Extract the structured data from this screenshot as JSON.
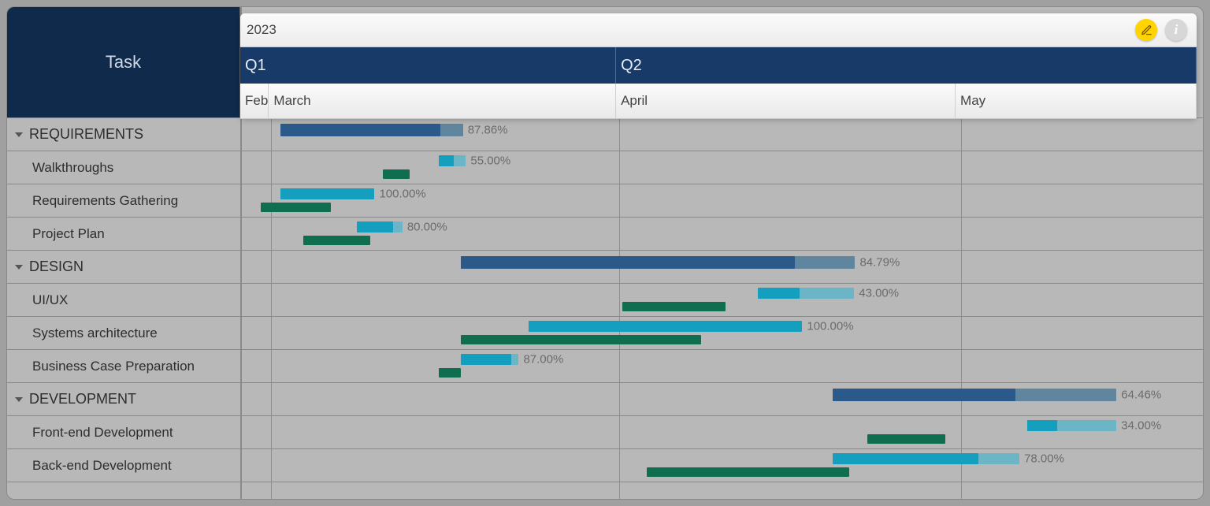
{
  "task_header": "Task",
  "year_label": "2023",
  "quarters": [
    "Q1",
    "Q2"
  ],
  "months": [
    "Feb",
    "March",
    "April",
    "May"
  ],
  "rows": [
    {
      "type": "group",
      "label": "REQUIREMENTS",
      "percent": "87.86%"
    },
    {
      "type": "task",
      "label": "Walkthroughs",
      "percent": "55.00%"
    },
    {
      "type": "task",
      "label": "Requirements Gathering",
      "percent": "100.00%"
    },
    {
      "type": "task",
      "label": "Project Plan",
      "percent": "80.00%"
    },
    {
      "type": "group",
      "label": "DESIGN",
      "percent": "84.79%"
    },
    {
      "type": "task",
      "label": "UI/UX",
      "percent": "43.00%"
    },
    {
      "type": "task",
      "label": "Systems architecture",
      "percent": "100.00%"
    },
    {
      "type": "task",
      "label": "Business Case Preparation",
      "percent": "87.00%"
    },
    {
      "type": "group",
      "label": "DEVELOPMENT",
      "percent": "64.46%"
    },
    {
      "type": "task",
      "label": "Front-end Development",
      "percent": "34.00%"
    },
    {
      "type": "task",
      "label": "Back-end Development",
      "percent": "78.00%"
    }
  ],
  "chart_data": {
    "type": "gantt",
    "xlabel": "",
    "ylabel": "",
    "time_axis_days": {
      "start": "2023-02-26",
      "end": "2023-05-30"
    },
    "tasks": [
      {
        "name": "REQUIREMENTS",
        "kind": "group",
        "progress_pct": 87.86,
        "summary": {
          "startPct": 4.0,
          "widthPct": 19.0
        }
      },
      {
        "name": "Walkthroughs",
        "kind": "task",
        "progress_pct": 55.0,
        "plan": {
          "startPct": 20.5,
          "widthPct": 2.8
        },
        "baseline": {
          "startPct": 14.7,
          "widthPct": 2.8
        }
      },
      {
        "name": "Requirements Gathering",
        "kind": "task",
        "progress_pct": 100.0,
        "plan": {
          "startPct": 4.0,
          "widthPct": 9.8
        },
        "baseline": {
          "startPct": 2.0,
          "widthPct": 7.3
        }
      },
      {
        "name": "Project Plan",
        "kind": "task",
        "progress_pct": 80.0,
        "plan": {
          "startPct": 12.0,
          "widthPct": 4.7
        },
        "baseline": {
          "startPct": 6.4,
          "widthPct": 7.0
        }
      },
      {
        "name": "DESIGN",
        "kind": "group",
        "progress_pct": 84.79,
        "summary": {
          "startPct": 22.8,
          "widthPct": 41.0
        }
      },
      {
        "name": "UI/UX",
        "kind": "task",
        "progress_pct": 43.0,
        "plan": {
          "startPct": 53.7,
          "widthPct": 10.0
        },
        "baseline": {
          "startPct": 39.6,
          "widthPct": 10.7
        }
      },
      {
        "name": "Systems architecture",
        "kind": "task",
        "progress_pct": 100.0,
        "plan": {
          "startPct": 29.8,
          "widthPct": 28.5
        },
        "baseline": {
          "startPct": 22.8,
          "widthPct": 25.0
        }
      },
      {
        "name": "Business Case Preparation",
        "kind": "task",
        "progress_pct": 87.0,
        "plan": {
          "startPct": 22.8,
          "widthPct": 6.0
        },
        "baseline": {
          "startPct": 20.5,
          "widthPct": 2.3
        }
      },
      {
        "name": "DEVELOPMENT",
        "kind": "group",
        "progress_pct": 64.46,
        "summary": {
          "startPct": 61.5,
          "widthPct": 29.5
        }
      },
      {
        "name": "Front-end Development",
        "kind": "task",
        "progress_pct": 34.0,
        "plan": {
          "startPct": 81.7,
          "widthPct": 9.3
        },
        "baseline": {
          "startPct": 65.1,
          "widthPct": 8.1
        }
      },
      {
        "name": "Back-end Development",
        "kind": "task",
        "progress_pct": 78.0,
        "plan": {
          "startPct": 61.5,
          "widthPct": 19.4
        },
        "baseline": {
          "startPct": 42.1,
          "widthPct": 21.1
        }
      }
    ],
    "month_boundaries_pct": [
      3.0,
      39.3,
      74.8
    ]
  }
}
